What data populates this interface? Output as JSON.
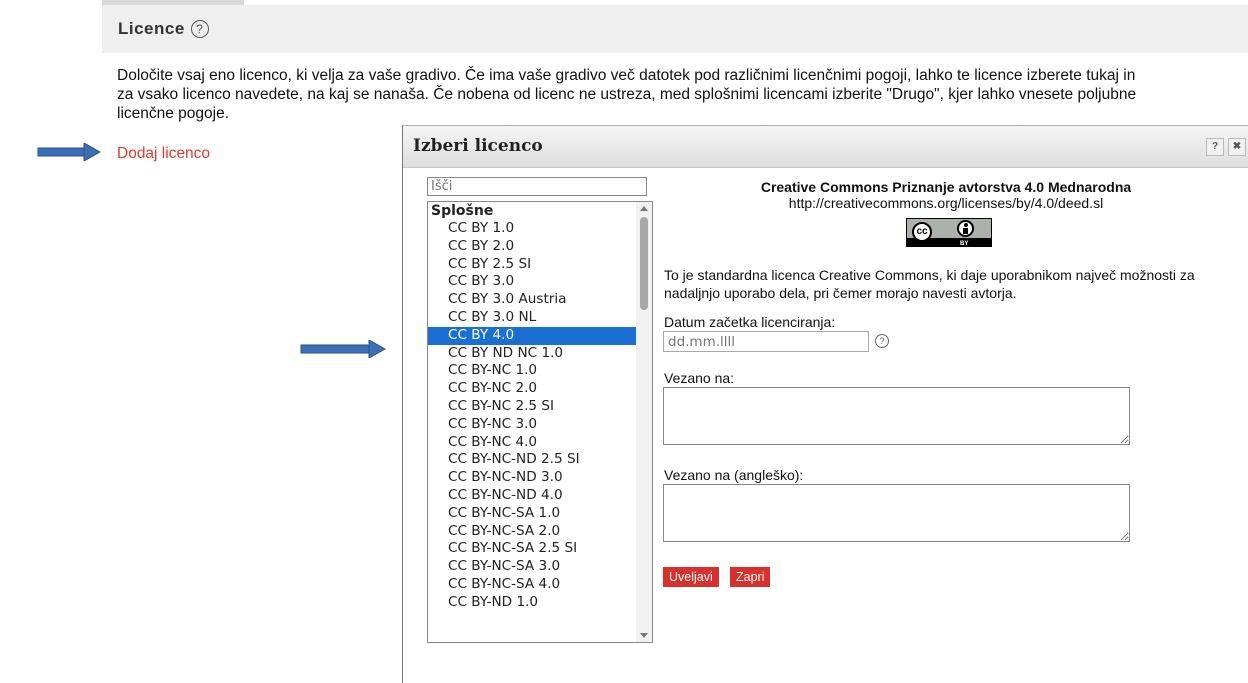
{
  "page": {
    "section_title": "Licence",
    "description": "Določite vsaj eno licenco, ki velja za vaše gradivo. Če ima vaše gradivo več datotek pod različnimi licenčnimi pogoji, lahko te licence izberete tukaj in za vsako licenco navedete, na kaj se nanaša. Če nobena od licenc ne ustreza, med splošnimi licencami izberite \"Drugo\", kjer lahko vnesete poljubne licenčne pogoje.",
    "add_license_link": "Dodaj licenco"
  },
  "dialog": {
    "title": "Izberi licenco",
    "help_button": "?",
    "close_button": "✖",
    "search_placeholder": "Išči",
    "group_label": "Splošne",
    "options": [
      "CC BY 1.0",
      "CC BY 2.0",
      "CC BY 2.5 SI",
      "CC BY 3.0",
      "CC BY 3.0 Austria",
      "CC BY 3.0 NL",
      "CC BY 4.0",
      "CC BY ND NC 1.0",
      "CC BY-NC 1.0",
      "CC BY-NC 2.0",
      "CC BY-NC 2.5 SI",
      "CC BY-NC 3.0",
      "CC BY-NC 4.0",
      "CC BY-NC-ND 2.5 SI",
      "CC BY-NC-ND 3.0",
      "CC BY-NC-ND 4.0",
      "CC BY-NC-SA 1.0",
      "CC BY-NC-SA 2.0",
      "CC BY-NC-SA 2.5 SI",
      "CC BY-NC-SA 3.0",
      "CC BY-NC-SA 4.0",
      "CC BY-ND 1.0"
    ],
    "selected_option": "CC BY 4.0",
    "license_title": "Creative Commons Priznanje avtorstva 4.0 Mednarodna",
    "license_url": "http://creativecommons.org/licenses/by/4.0/deed.sl",
    "badge_cc": "cc",
    "badge_by": "BY",
    "license_description": "To je standardna licenca Creative Commons, ki daje uporabnikom največ možnosti za nadaljnjo uporabo dela, pri čemer morajo navesti avtorja.",
    "date_label": "Datum začetka licenciranja:",
    "date_placeholder": "dd.mm.llll",
    "linked_label": "Vezano na:",
    "linked_en_label": "Vezano na (angleško):",
    "apply_button": "Uveljavi",
    "close_dialog_button": "Zapri"
  },
  "colors": {
    "accent_red": "#d8302a",
    "link_red": "#e03a2d",
    "selection_blue": "#1a6fd4",
    "annotation_arrow": "#3d6fb6"
  }
}
